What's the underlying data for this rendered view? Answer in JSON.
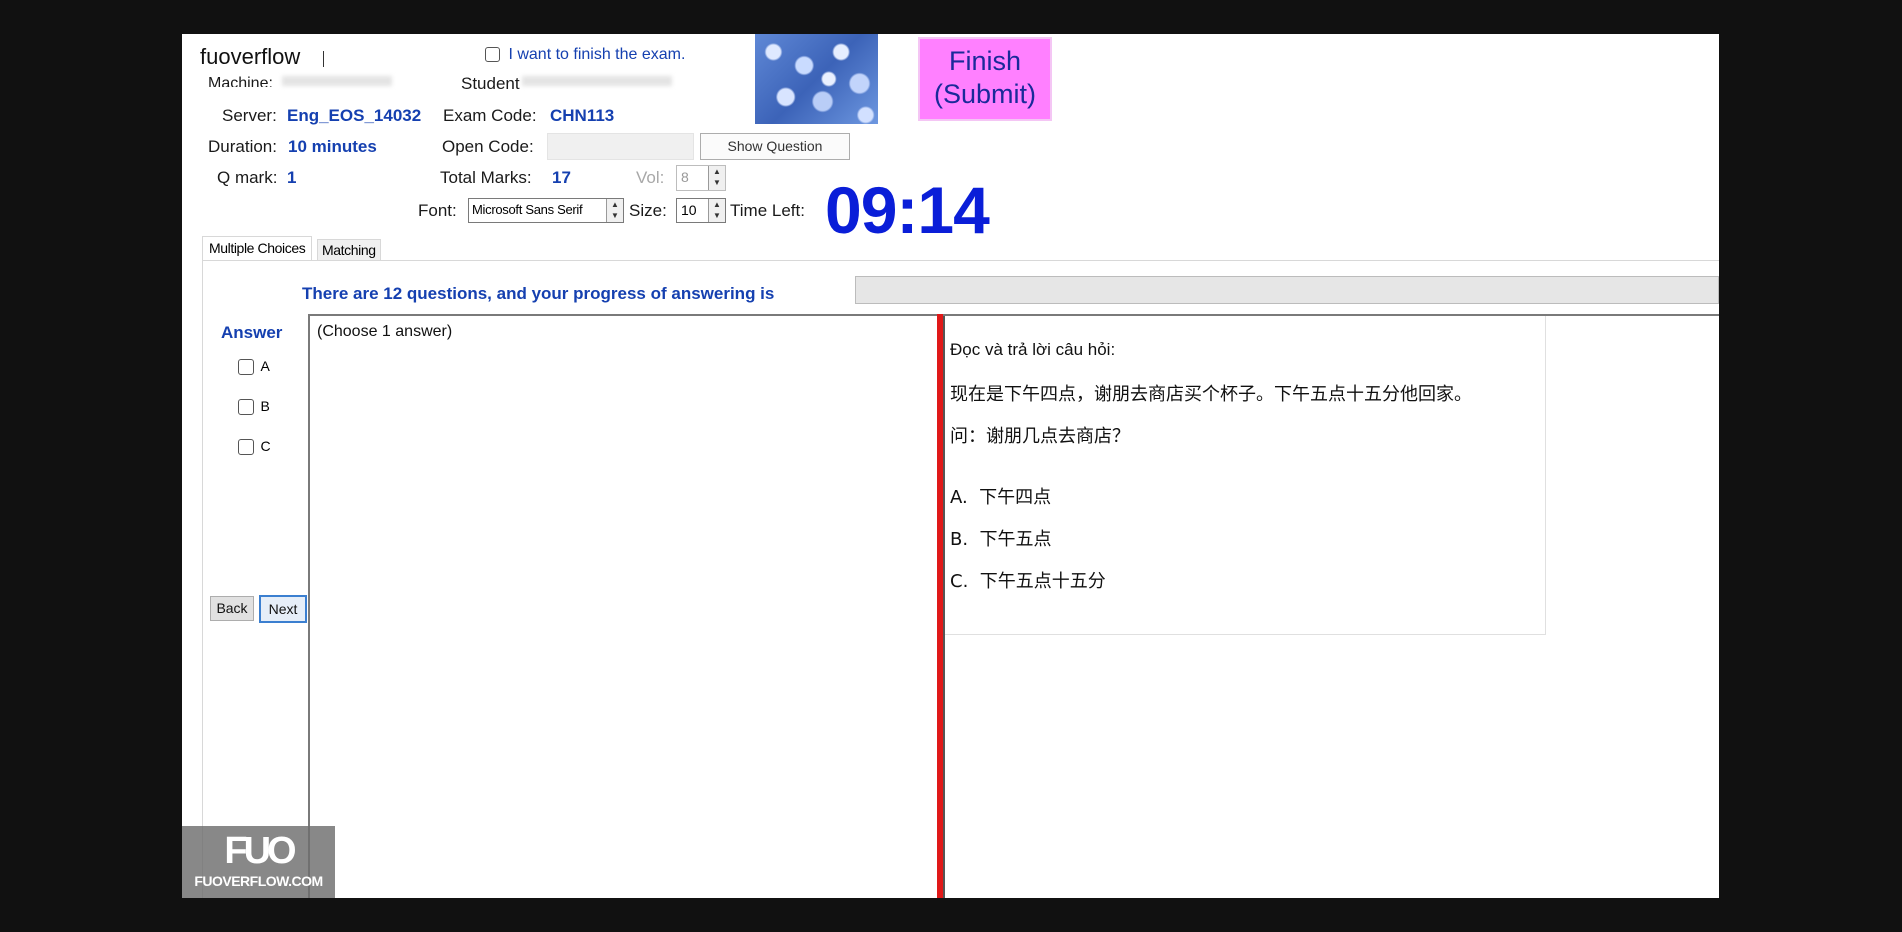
{
  "brand": "fuoverflow",
  "finish_checkbox_label": "I want to finish the exam.",
  "finish_button_line1": "Finish",
  "finish_button_line2": "(Submit)",
  "info": {
    "machine_label": "Machine:",
    "student_label": "Student",
    "server_label": "Server:",
    "server_value": "Eng_EOS_14032",
    "exam_code_label": "Exam Code:",
    "exam_code_value": "CHN113",
    "duration_label": "Duration:",
    "duration_value": "10 minutes",
    "open_code_label": "Open Code:",
    "show_question_label": "Show Question",
    "qmark_label": "Q mark:",
    "qmark_value": "1",
    "total_marks_label": "Total Marks:",
    "total_marks_value": "17",
    "vol_label": "Vol:",
    "vol_value": "8",
    "font_label": "Font:",
    "font_value": "Microsoft Sans Serif",
    "size_label": "Size:",
    "size_value": "10",
    "time_left_label": "Time Left:",
    "time_left_value": "09:14"
  },
  "tabs": [
    "Multiple Choices",
    "Matching"
  ],
  "progress_text": "There are 12 questions, and your progress of answering is",
  "progress_fraction": 0,
  "answer": {
    "heading": "Answer",
    "options": [
      "A",
      "B",
      "C"
    ]
  },
  "nav": {
    "back": "Back",
    "next": "Next"
  },
  "instruction": "(Choose 1 answer)",
  "question": {
    "prompt": "Đọc và trả lời câu hỏi:",
    "passage": "现在是下午四点，谢朋去商店买个杯子。下午五点十五分他回家。",
    "ask": "问：谢朋几点去商店？",
    "choices": [
      "A.  下午四点",
      "B.  下午五点",
      "C.  下午五点十五分"
    ]
  },
  "watermark": {
    "logo": "FUO",
    "site": "FUOVERFLOW.COM"
  },
  "colors": {
    "finish_bg": "#ff80ff",
    "timer": "#0a1ed8",
    "accent_blue": "#1540b0",
    "divider_red": "#e01818"
  }
}
